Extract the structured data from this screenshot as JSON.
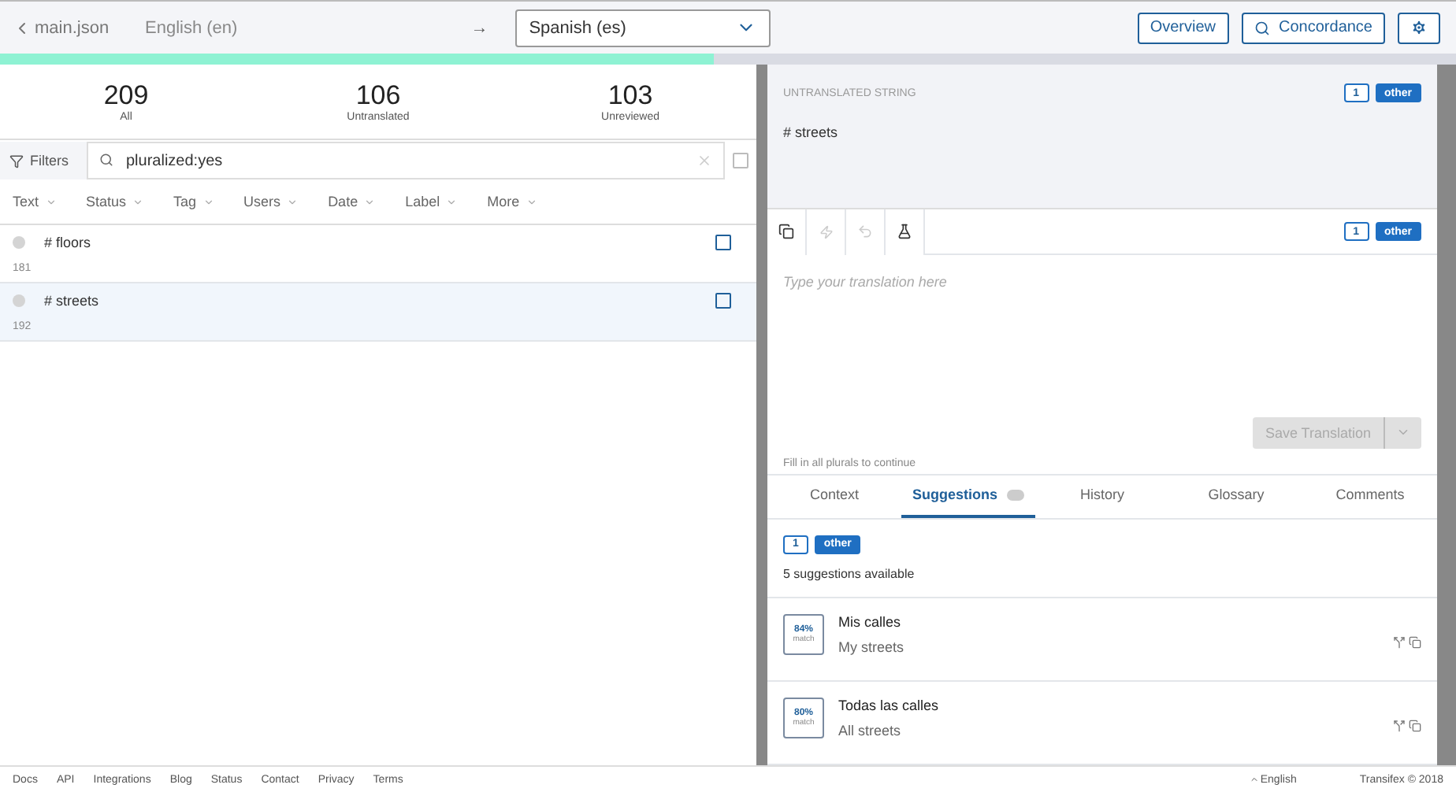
{
  "header": {
    "back_label": "main.json",
    "source_language": "English (en)",
    "arrow": "→",
    "target_language": "Spanish (es)",
    "buttons": [
      {
        "kind": "text",
        "label": "Overview"
      },
      {
        "kind": "search",
        "label": "Concordance"
      },
      {
        "kind": "settings"
      }
    ]
  },
  "progress": {
    "level": 0.49
  },
  "stats": [
    {
      "value": "209",
      "label": "All"
    },
    {
      "value": "106",
      "label": "Untranslated"
    },
    {
      "value": "103",
      "label": "Unreviewed"
    }
  ],
  "filter": {
    "label": "Filters",
    "value": "pluralized:yes",
    "checked": false
  },
  "facets": [
    "Text",
    "Status",
    "Tag",
    "Users",
    "Date",
    "Label",
    "More"
  ],
  "strings": [
    {
      "text": "# floors",
      "number": "181",
      "selected": false,
      "checked": false
    },
    {
      "text": "# streets",
      "number": "192",
      "selected": true,
      "checked": false
    }
  ],
  "source": {
    "heading": "UNTRANSLATED STRING",
    "text": "# streets",
    "plurals": [
      {
        "label": "1",
        "selected": false
      },
      {
        "label": "other",
        "selected": true
      }
    ]
  },
  "editor": {
    "tools": [
      {
        "kind": "copy",
        "disabled": false
      },
      {
        "kind": "bolt",
        "disabled": true
      },
      {
        "kind": "undo",
        "disabled": true
      },
      {
        "kind": "flask",
        "disabled": false
      }
    ],
    "plurals": [
      {
        "label": "1",
        "selected": false
      },
      {
        "label": "other",
        "selected": true
      }
    ],
    "placeholder": "Type your translation here",
    "save_label": "Save Translation",
    "disabled": true,
    "note": "Fill in all plurals to continue"
  },
  "tabs": [
    {
      "label": "Context",
      "selected": false
    },
    {
      "label": "Suggestions",
      "selected": true
    },
    {
      "label": "History",
      "selected": false
    },
    {
      "label": "Glossary",
      "selected": false
    },
    {
      "label": "Comments",
      "selected": false
    }
  ],
  "suggestions": {
    "plurals": [
      {
        "label": "1",
        "selected": false
      },
      {
        "label": "other",
        "selected": true
      }
    ],
    "summary": "5 suggestions available",
    "items": [
      {
        "match": "84%",
        "match_label": "match",
        "text": "Mis calles",
        "source": "My streets"
      },
      {
        "match": "80%",
        "match_label": "match",
        "text": "Todas las calles",
        "source": "All streets"
      }
    ]
  },
  "footer": {
    "links": [
      "Docs",
      "API",
      "Integrations",
      "Blog",
      "Status",
      "Contact",
      "Privacy",
      "Terms"
    ],
    "language": "English",
    "copyright": "Transifex © 2018"
  }
}
